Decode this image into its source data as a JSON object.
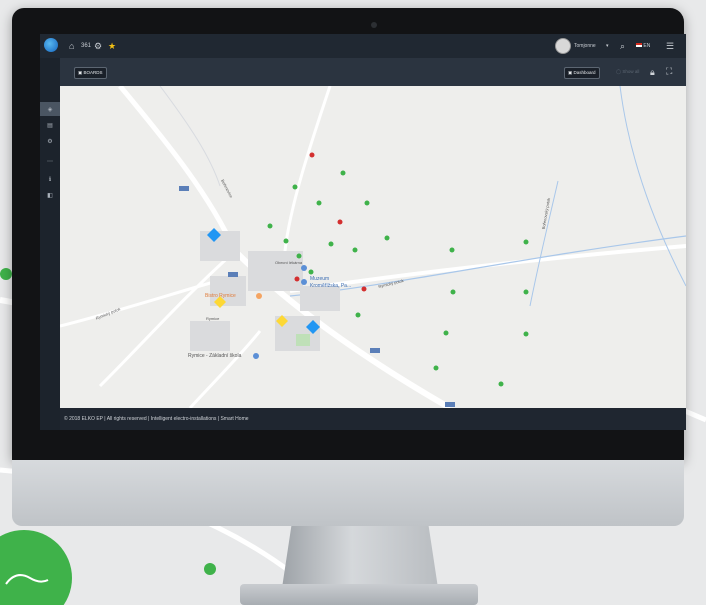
{
  "app": {
    "user_name": "Tomjonne",
    "language": "EN",
    "topbar_label": "361"
  },
  "toolbar": {
    "boards_label": "BOARDS",
    "dashboard_label": "Dashboard",
    "secondary_label": "Show all"
  },
  "map": {
    "places": {
      "bistro": "Bistro Rymice",
      "museum_line1": "Muzeum",
      "museum_line2": "Kroměřížska, Pa...",
      "obec": "Obecní lékárna",
      "school": "Rymice - Základní škola",
      "road1": "Rymice",
      "road2": "Bořenovice",
      "field1": "Rymický potok",
      "field2": "Rymický potok",
      "field3": "Bořenovský potok"
    }
  },
  "footer": {
    "text": "© 2018 ELKO EP | All rights reserved | Intelligent electro-installations | Smart Home"
  },
  "colors": {
    "dot_green": "#3fb24a",
    "dot_red": "#d32f2f",
    "marker_blue": "#2196f3",
    "marker_yellow": "#fdd835",
    "topbar": "#202832"
  },
  "icons": {
    "home": "home-icon",
    "gear": "gear-icon",
    "star": "star-icon",
    "search": "search-icon",
    "menu": "menu-icon",
    "lock": "lock-icon",
    "fullscreen": "fullscreen-icon"
  }
}
